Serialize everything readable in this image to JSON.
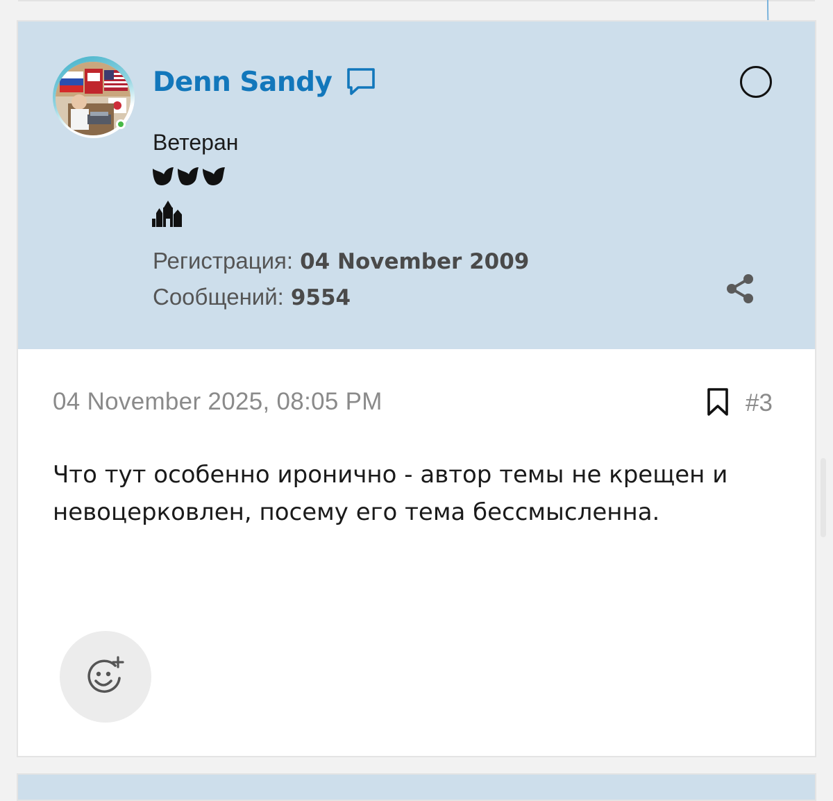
{
  "post": {
    "author": {
      "name": "Denn Sandy",
      "title": "Ветеран",
      "online": true,
      "awards_icon": "birds-awards-icon",
      "rank_icon": "church-rank-icon"
    },
    "stats": {
      "registration_label": "Регистрация:",
      "registration_value": "04 November 2009",
      "messages_label": "Сообщений:",
      "messages_value": "9554"
    },
    "date": "04 November 2025, 08:05 PM",
    "number": "#3",
    "body": "Что тут особенно иронично - автор темы не крещен и невоцерковлен, посему его тема бессмысленна.",
    "colors": {
      "header_bg": "#cddeeb",
      "username": "#1277bb",
      "online": "#47b947"
    }
  }
}
